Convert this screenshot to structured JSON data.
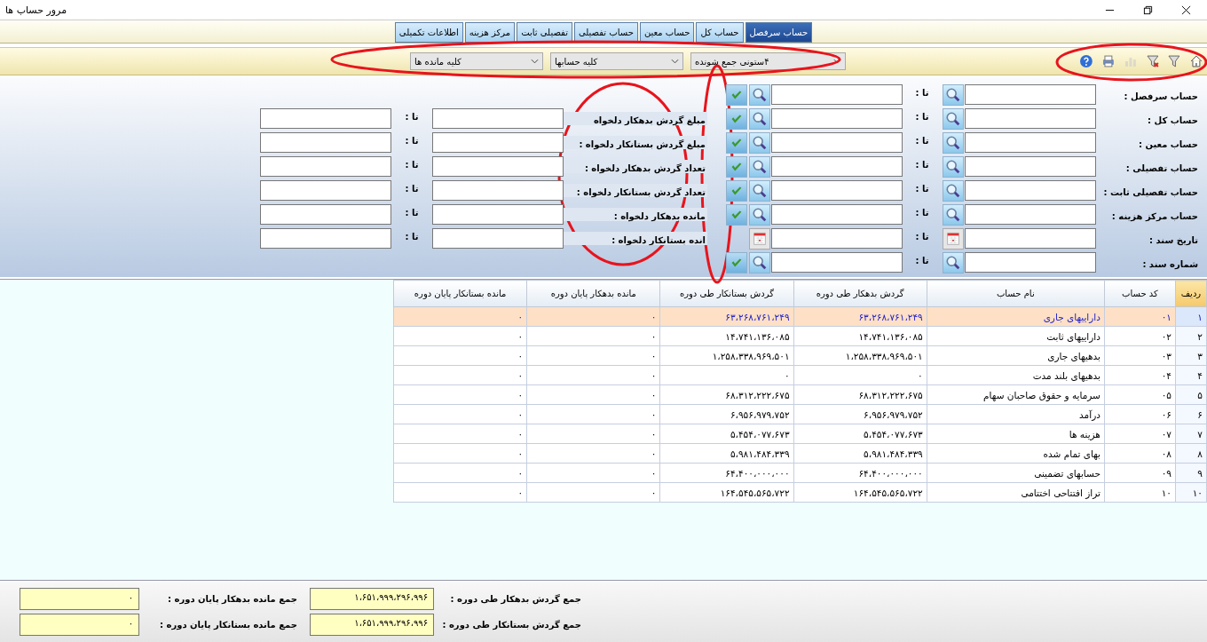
{
  "window": {
    "title": "مرور حساب ها"
  },
  "tabs": [
    {
      "label": "حساب سرفصل",
      "selected": true
    },
    {
      "label": "حساب کل",
      "selected": false
    },
    {
      "label": "حساب معین",
      "selected": false
    },
    {
      "label": "حساب تفصیلی",
      "selected": false
    },
    {
      "label": "تفصیلی ثابت",
      "selected": false
    },
    {
      "label": "مرکز هزینه",
      "selected": false
    },
    {
      "label": "اطلاعات تکمیلی",
      "selected": false
    }
  ],
  "toolbar": {
    "dropdowns": [
      {
        "value": "۴ستونی جمع شونده"
      },
      {
        "value": "کلیه  حسابها"
      },
      {
        "value": "کلیه مانده ها"
      }
    ]
  },
  "filters": {
    "account_rows": [
      {
        "label": "حساب سرفصل :",
        "kind": "search",
        "to_label": "تا :",
        "confirm": true
      },
      {
        "label": "حساب کل :",
        "kind": "search",
        "to_label": "تا :",
        "confirm": true
      },
      {
        "label": "حساب معین :",
        "kind": "search",
        "to_label": "تا :",
        "confirm": true
      },
      {
        "label": "حساب تفصیلی :",
        "kind": "search",
        "to_label": "تا :",
        "confirm": true
      },
      {
        "label": "حساب تفصیلی ثابت :",
        "kind": "search",
        "to_label": "تا :",
        "confirm": true
      },
      {
        "label": "حساب مرکز هزینه :",
        "kind": "search",
        "to_label": "تا :",
        "confirm": true
      },
      {
        "label": "تاریخ سند :",
        "kind": "date",
        "to_label": "تا :",
        "confirm": false
      },
      {
        "label": "شماره سند :",
        "kind": "search",
        "to_label": "تا :",
        "confirm": true
      }
    ],
    "amount_rows": [
      {
        "label": "مبلغ گردش بدهکار دلخواه",
        "to_label": "تا :"
      },
      {
        "label": "مبلغ گردش بستانکار دلخواه :",
        "to_label": "تا :"
      },
      {
        "label": "تعداد گردش بدهکار دلخواه :",
        "to_label": "تا :"
      },
      {
        "label": "تعداد گردش بستانکار دلخواه :",
        "to_label": "تا :"
      },
      {
        "label": "مانده بدهکار دلخواه :",
        "to_label": "تا :"
      },
      {
        "label": "انده بستانکار دلخواه :",
        "to_label": "تا :"
      }
    ]
  },
  "table": {
    "columns": [
      "ردیف",
      "کد حساب",
      "نام حساب",
      "گردش بدهکار طی دوره",
      "گردش بستانکار طی دوره",
      "مانده بدهکار پایان دوره",
      "مانده بستانکار پایان دوره"
    ],
    "rows": [
      {
        "selected": true,
        "cells": [
          "۱",
          "۰۱",
          "داراییهای جاری",
          "۶۳،۲۶۸،۷۶۱،۲۴۹",
          "۶۳،۲۶۸،۷۶۱،۲۴۹",
          "۰",
          "۰"
        ]
      },
      {
        "selected": false,
        "cells": [
          "۲",
          "۰۲",
          "داراییهای ثابت",
          "۱۴،۷۴۱،۱۳۶،۰۸۵",
          "۱۴،۷۴۱،۱۳۶،۰۸۵",
          "۰",
          "۰"
        ]
      },
      {
        "selected": false,
        "cells": [
          "۳",
          "۰۳",
          "بدهیهای جاری",
          "۱،۲۵۸،۳۳۸،۹۶۹،۵۰۱",
          "۱،۲۵۸،۳۳۸،۹۶۹،۵۰۱",
          "۰",
          "۰"
        ]
      },
      {
        "selected": false,
        "cells": [
          "۴",
          "۰۴",
          "بدهیهای بلند مدت",
          "۰",
          "۰",
          "۰",
          "۰"
        ]
      },
      {
        "selected": false,
        "cells": [
          "۵",
          "۰۵",
          "سرمایه و حقوق صاحبان سهام",
          "۶۸،۳۱۲،۲۲۲،۶۷۵",
          "۶۸،۳۱۲،۲۲۲،۶۷۵",
          "۰",
          "۰"
        ]
      },
      {
        "selected": false,
        "cells": [
          "۶",
          "۰۶",
          "درآمد",
          "۶،۹۵۶،۹۷۹،۷۵۲",
          "۶،۹۵۶،۹۷۹،۷۵۲",
          "۰",
          "۰"
        ]
      },
      {
        "selected": false,
        "cells": [
          "۷",
          "۰۷",
          "هزینه ها",
          "۵،۴۵۴،۰۷۷،۶۷۳",
          "۵،۴۵۴،۰۷۷،۶۷۳",
          "۰",
          "۰"
        ]
      },
      {
        "selected": false,
        "cells": [
          "۸",
          "۰۸",
          "بهای تمام شده",
          "۵،۹۸۱،۴۸۴،۳۳۹",
          "۵،۹۸۱،۴۸۴،۳۳۹",
          "۰",
          "۰"
        ]
      },
      {
        "selected": false,
        "cells": [
          "۹",
          "۰۹",
          "حسابهای تضمینی",
          "۶۴،۴۰۰،۰۰۰،۰۰۰",
          "۶۴،۴۰۰،۰۰۰،۰۰۰",
          "۰",
          "۰"
        ]
      },
      {
        "selected": false,
        "cells": [
          "۱۰",
          "۱۰",
          "تراز افتتاحی اختتامی",
          "۱۶۴،۵۴۵،۵۶۵،۷۲۲",
          "۱۶۴،۵۴۵،۵۶۵،۷۲۲",
          "۰",
          "۰"
        ]
      }
    ]
  },
  "totals": [
    {
      "label": "جمع گردش بدهکار طی دوره :",
      "value": "۱،۶۵۱،۹۹۹،۲۹۶،۹۹۶"
    },
    {
      "label": "جمع مانده بدهکار پایان دوره :",
      "value": "۰"
    },
    {
      "label": "جمع گردش بستانکار طی دوره :",
      "value": "۱،۶۵۱،۹۹۹،۲۹۶،۹۹۶"
    },
    {
      "label": "جمع مانده بستانکار پایان دوره :",
      "value": "۰"
    }
  ]
}
